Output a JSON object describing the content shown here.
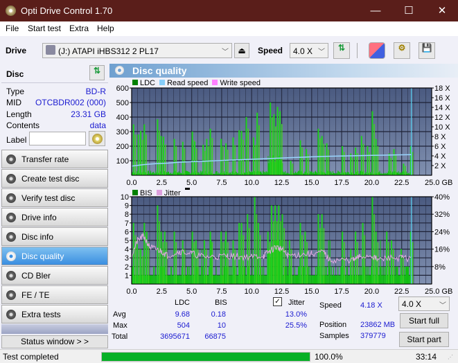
{
  "window": {
    "title": "Opti Drive Control 1.70",
    "min": "—",
    "max": "☐",
    "close": "✕"
  },
  "menu": [
    "File",
    "Start test",
    "Extra",
    "Help"
  ],
  "toolbar": {
    "drive_label": "Drive",
    "drive_value": "(J:)  ATAPI iHBS312   2 PL17",
    "speed_label": "Speed",
    "speed_value": "4.0 X"
  },
  "disc": {
    "header": "Disc",
    "rows": [
      {
        "k": "Type",
        "v": "BD-R"
      },
      {
        "k": "MID",
        "v": "OTCBDR002 (000)"
      },
      {
        "k": "Length",
        "v": "23.31 GB"
      },
      {
        "k": "Contents",
        "v": "data"
      }
    ],
    "label_key": "Label",
    "label_value": ""
  },
  "nav": [
    {
      "label": "Transfer rate",
      "active": false
    },
    {
      "label": "Create test disc",
      "active": false
    },
    {
      "label": "Verify test disc",
      "active": false
    },
    {
      "label": "Drive info",
      "active": false
    },
    {
      "label": "Disc info",
      "active": false
    },
    {
      "label": "Disc quality",
      "active": true
    },
    {
      "label": "CD Bler",
      "active": false
    },
    {
      "label": "FE / TE",
      "active": false
    },
    {
      "label": "Extra tests",
      "active": false
    }
  ],
  "status_window_btn": "Status window > >",
  "panel": {
    "title": "Disc quality"
  },
  "chart_data": [
    {
      "type": "bar",
      "title": "LDC / Read speed",
      "legend": [
        "LDC",
        "Read speed",
        "Write speed"
      ],
      "legend_colors": [
        "#008000",
        "#87cefa",
        "#ff80ff"
      ],
      "x_ticks": [
        "0.0",
        "2.5",
        "5.0",
        "7.5",
        "10.0",
        "12.5",
        "15.0",
        "17.5",
        "20.0",
        "22.5",
        "25.0 GB"
      ],
      "xlim": [
        0,
        25
      ],
      "y_ticks": [
        "100",
        "200",
        "300",
        "400",
        "500",
        "600"
      ],
      "ylim": [
        0,
        600
      ],
      "y2_ticks": [
        "2 X",
        "4 X",
        "6 X",
        "8 X",
        "10 X",
        "12 X",
        "14 X",
        "16 X",
        "18 X"
      ],
      "y2lim": [
        0,
        18
      ],
      "end_marker_gb": 23.31,
      "read_speed": [
        [
          0,
          1.9
        ],
        [
          1,
          2.2
        ],
        [
          2,
          2.4
        ],
        [
          3,
          2.5
        ],
        [
          4,
          2.7
        ],
        [
          5,
          2.8
        ],
        [
          6,
          2.9
        ],
        [
          7,
          3.0
        ],
        [
          8,
          3.1
        ],
        [
          9,
          3.2
        ],
        [
          10,
          3.3
        ],
        [
          11,
          3.4
        ],
        [
          12,
          3.5
        ],
        [
          13,
          3.6
        ],
        [
          14,
          3.7
        ],
        [
          15,
          3.8
        ],
        [
          16,
          3.9
        ],
        [
          17,
          3.95
        ],
        [
          18,
          4.0
        ],
        [
          19,
          4.05
        ],
        [
          20,
          4.1
        ],
        [
          21,
          4.15
        ],
        [
          22,
          4.2
        ],
        [
          23.3,
          4.25
        ]
      ],
      "ldc_peaks": [
        [
          0.1,
          350
        ],
        [
          0.5,
          280
        ],
        [
          0.7,
          305
        ],
        [
          1.0,
          350
        ],
        [
          2.1,
          385
        ],
        [
          2.4,
          270
        ],
        [
          2.6,
          265
        ],
        [
          3.5,
          250
        ],
        [
          4.2,
          230
        ],
        [
          5.0,
          300
        ],
        [
          5.2,
          230
        ],
        [
          5.9,
          210
        ],
        [
          6.2,
          250
        ],
        [
          6.5,
          320
        ],
        [
          7.4,
          250
        ],
        [
          7.8,
          220
        ],
        [
          8.4,
          260
        ],
        [
          8.9,
          310
        ],
        [
          9.1,
          305
        ],
        [
          9.5,
          400
        ],
        [
          10.1,
          260
        ],
        [
          10.4,
          430
        ],
        [
          11.5,
          500
        ],
        [
          11.8,
          420
        ],
        [
          12.1,
          470
        ],
        [
          12.3,
          440
        ],
        [
          13.2,
          100
        ],
        [
          14.0,
          240
        ],
        [
          14.5,
          180
        ],
        [
          15.5,
          320
        ],
        [
          15.8,
          270
        ],
        [
          16.2,
          220
        ],
        [
          17.5,
          200
        ],
        [
          18.2,
          150
        ],
        [
          18.6,
          190
        ],
        [
          19.1,
          270
        ],
        [
          19.6,
          200
        ],
        [
          20.0,
          440
        ],
        [
          20.3,
          250
        ],
        [
          21.4,
          150
        ],
        [
          21.8,
          180
        ],
        [
          22.6,
          80
        ],
        [
          23.2,
          200
        ]
      ],
      "ldc_baseline": 20
    },
    {
      "type": "bar",
      "title": "BIS / Jitter",
      "legend": [
        "BIS",
        "Jitter"
      ],
      "legend_colors": [
        "#008000",
        "#dda0dd"
      ],
      "x_ticks": [
        "0.0",
        "2.5",
        "5.0",
        "7.5",
        "10.0",
        "12.5",
        "15.0",
        "17.5",
        "20.0",
        "22.5",
        "25.0 GB"
      ],
      "xlim": [
        0,
        25
      ],
      "y_ticks": [
        "1",
        "2",
        "3",
        "4",
        "5",
        "6",
        "7",
        "8",
        "9",
        "10"
      ],
      "ylim": [
        0,
        10
      ],
      "y2_ticks": [
        "8%",
        "16%",
        "24%",
        "32%",
        "40%"
      ],
      "y2lim": [
        0,
        40
      ],
      "end_marker_gb": 23.31,
      "bis_peaks": [
        [
          0.1,
          7
        ],
        [
          0.4,
          5
        ],
        [
          0.7,
          4
        ],
        [
          1.0,
          7
        ],
        [
          1.2,
          6
        ],
        [
          2.1,
          9
        ],
        [
          2.4,
          6
        ],
        [
          2.7,
          6
        ],
        [
          3.5,
          6
        ],
        [
          4.2,
          5
        ],
        [
          5.0,
          6
        ],
        [
          5.3,
          5
        ],
        [
          6.0,
          5
        ],
        [
          6.5,
          6
        ],
        [
          7.4,
          6
        ],
        [
          7.8,
          6
        ],
        [
          8.4,
          5
        ],
        [
          8.9,
          7
        ],
        [
          9.1,
          7
        ],
        [
          9.6,
          8
        ],
        [
          10.2,
          10
        ],
        [
          10.5,
          7
        ],
        [
          11.3,
          6
        ],
        [
          11.6,
          9
        ],
        [
          11.9,
          9
        ],
        [
          12.2,
          9
        ],
        [
          12.5,
          8
        ],
        [
          13.1,
          5
        ],
        [
          14.0,
          7
        ],
        [
          14.4,
          6
        ],
        [
          15.5,
          8
        ],
        [
          15.8,
          8
        ],
        [
          17.5,
          6
        ],
        [
          18.2,
          4
        ],
        [
          18.6,
          6
        ],
        [
          19.2,
          7
        ],
        [
          20.0,
          10
        ],
        [
          20.3,
          6
        ],
        [
          21.2,
          6
        ],
        [
          21.6,
          5
        ],
        [
          22.4,
          4
        ],
        [
          23.2,
          6
        ]
      ],
      "jitter_pct": [
        [
          0,
          13
        ],
        [
          0.5,
          20
        ],
        [
          1.0,
          22
        ],
        [
          1.5,
          17
        ],
        [
          2.0,
          16
        ],
        [
          2.5,
          15
        ],
        [
          3.0,
          13
        ],
        [
          4.0,
          15
        ],
        [
          5.0,
          14
        ],
        [
          6.0,
          12.5
        ],
        [
          7.0,
          12.5
        ],
        [
          8.0,
          13
        ],
        [
          9.0,
          12.5
        ],
        [
          10.0,
          12.5
        ],
        [
          11.0,
          13
        ],
        [
          11.5,
          15
        ],
        [
          12.0,
          17
        ],
        [
          12.5,
          16
        ],
        [
          13.0,
          13
        ],
        [
          14.0,
          13.5
        ],
        [
          15.0,
          14
        ],
        [
          16.0,
          14.5
        ],
        [
          16.5,
          11
        ],
        [
          17.5,
          11
        ],
        [
          18.5,
          11
        ],
        [
          19.0,
          12.5
        ],
        [
          20.0,
          13
        ],
        [
          20.5,
          11
        ],
        [
          21.5,
          12
        ],
        [
          22.5,
          12
        ],
        [
          23.3,
          11.5
        ]
      ]
    }
  ],
  "stats": {
    "col_ldc": "LDC",
    "col_bis": "BIS",
    "jitter_label": "Jitter",
    "jitter_checked": true,
    "rows": [
      {
        "k": "Avg",
        "ldc": "9.68",
        "bis": "0.18",
        "jit": "13.0%"
      },
      {
        "k": "Max",
        "ldc": "504",
        "bis": "10",
        "jit": "25.5%"
      },
      {
        "k": "Total",
        "ldc": "3695671",
        "bis": "66875",
        "jit": ""
      }
    ],
    "speed_label": "Speed",
    "speed_value": "4.18 X",
    "position_label": "Position",
    "position_value": "23862 MB",
    "samples_label": "Samples",
    "samples_value": "379779",
    "speed_select": "4.0 X",
    "start_full": "Start full",
    "start_part": "Start part"
  },
  "statusbar": {
    "text": "Test completed",
    "progress": 100,
    "progress_text": "100.0%",
    "time": "33:14"
  }
}
